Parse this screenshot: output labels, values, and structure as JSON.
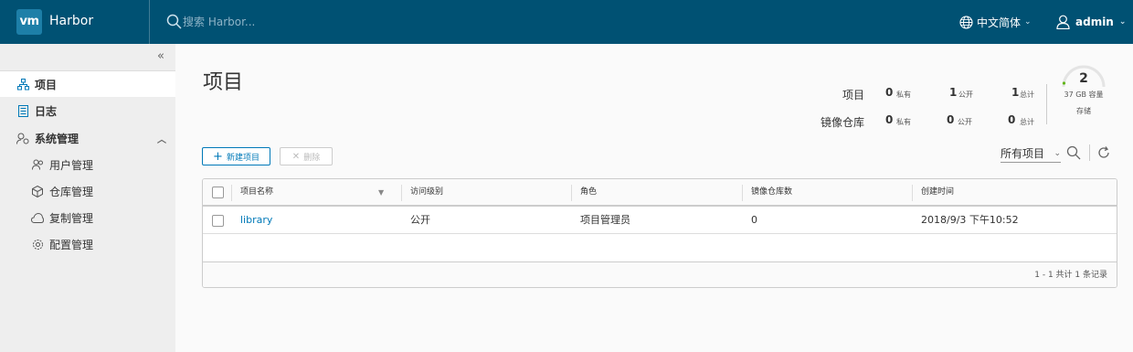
{
  "header": {
    "logo": "vm",
    "app_title": "Harbor",
    "search_placeholder": "搜索 Harbor...",
    "language": "中文简体",
    "user": "admin"
  },
  "sidebar": {
    "items": [
      {
        "label": "项目",
        "icon": "projects-icon"
      },
      {
        "label": "日志",
        "icon": "logs-icon"
      },
      {
        "label": "系统管理",
        "icon": "system-admin-icon"
      }
    ],
    "sub_items": [
      {
        "label": "用户管理",
        "icon": "users-icon"
      },
      {
        "label": "仓库管理",
        "icon": "registries-icon"
      },
      {
        "label": "复制管理",
        "icon": "replication-icon"
      },
      {
        "label": "配置管理",
        "icon": "config-icon"
      }
    ]
  },
  "main": {
    "title": "项目",
    "stats": {
      "projects_label": "项目",
      "repos_label": "镜像仓库",
      "project_private": "0",
      "project_public": "1",
      "project_total": "1",
      "repo_private": "0",
      "repo_public": "0",
      "repo_total": "0",
      "private_label": "私有",
      "public_label": "公开",
      "total_label": "总计",
      "storage_count": "2",
      "storage_capacity": "37 GB 容量",
      "storage_label": "存储"
    },
    "toolbar": {
      "new_project": "新建项目",
      "delete": "删除",
      "filter_value": "所有项目"
    },
    "table": {
      "columns": [
        "项目名称",
        "访问级别",
        "角色",
        "镜像仓库数",
        "创建时间"
      ],
      "rows": [
        {
          "name": "library",
          "access": "公开",
          "role": "项目管理员",
          "repos": "0",
          "created": "2018/9/3 下午10:52"
        }
      ],
      "footer": "1 - 1 共计 1 条记录"
    }
  },
  "colors": {
    "header_bg": "#005173",
    "accent": "#0079b8",
    "sidebar_bg": "#eeeeee"
  }
}
